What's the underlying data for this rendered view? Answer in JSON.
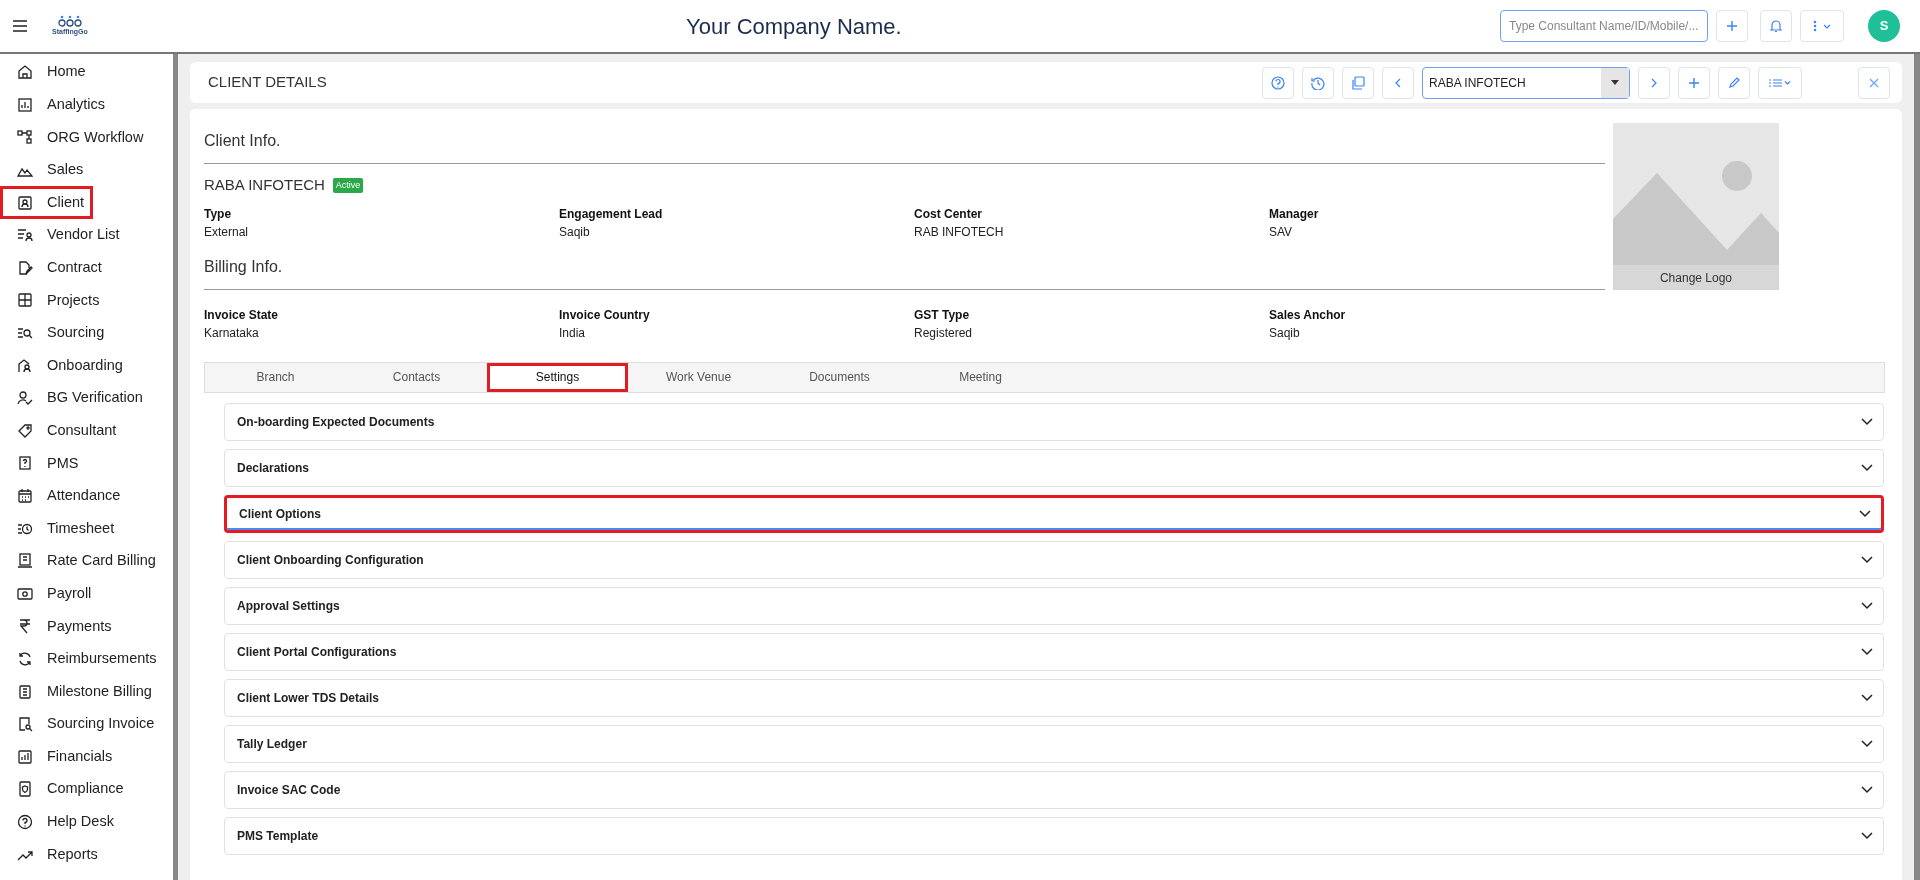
{
  "topbar": {
    "logo_text": "StaffingGo",
    "company": "Your Company Name.",
    "search": {
      "placeholder": "Type Consultant Name/ID/Mobile/..."
    },
    "avatar": "S"
  },
  "sidebar": {
    "items": [
      {
        "label": "Home",
        "highlighted": false
      },
      {
        "label": "Analytics",
        "highlighted": false
      },
      {
        "label": "ORG Workflow",
        "highlighted": false
      },
      {
        "label": "Sales",
        "highlighted": false
      },
      {
        "label": "Client",
        "highlighted": true
      },
      {
        "label": "Vendor List",
        "highlighted": false
      },
      {
        "label": "Contract",
        "highlighted": false
      },
      {
        "label": "Projects",
        "highlighted": false
      },
      {
        "label": "Sourcing",
        "highlighted": false
      },
      {
        "label": "Onboarding",
        "highlighted": false
      },
      {
        "label": "BG Verification",
        "highlighted": false
      },
      {
        "label": "Consultant",
        "highlighted": false
      },
      {
        "label": "PMS",
        "highlighted": false
      },
      {
        "label": "Attendance",
        "highlighted": false
      },
      {
        "label": "Timesheet",
        "highlighted": false
      },
      {
        "label": "Rate Card Billing",
        "highlighted": false
      },
      {
        "label": "Payroll",
        "highlighted": false
      },
      {
        "label": "Payments",
        "highlighted": false
      },
      {
        "label": "Reimbursements",
        "highlighted": false
      },
      {
        "label": "Milestone Billing",
        "highlighted": false
      },
      {
        "label": "Sourcing Invoice",
        "highlighted": false
      },
      {
        "label": "Financials",
        "highlighted": false
      },
      {
        "label": "Compliance",
        "highlighted": false
      },
      {
        "label": "Help Desk",
        "highlighted": false
      },
      {
        "label": "Reports",
        "highlighted": false
      }
    ]
  },
  "header": {
    "title": "CLIENT DETAILS",
    "client_select": "RABA INFOTECH"
  },
  "client_info": {
    "heading": "Client Info.",
    "name": "RABA INFOTECH",
    "status": "Active",
    "fields": [
      {
        "label": "Type",
        "value": "External"
      },
      {
        "label": "Engagement Lead",
        "value": "Saqib"
      },
      {
        "label": "Cost Center",
        "value": "RAB INFOTECH"
      },
      {
        "label": "Manager",
        "value": "SAV"
      }
    ]
  },
  "billing_info": {
    "heading": "Billing Info.",
    "fields": [
      {
        "label": "Invoice State",
        "value": "Karnataka"
      },
      {
        "label": "Invoice Country",
        "value": "India"
      },
      {
        "label": "GST Type",
        "value": "Registered"
      },
      {
        "label": "Sales Anchor",
        "value": "Saqib"
      }
    ]
  },
  "logo": {
    "button": "Change Logo"
  },
  "tabs": [
    {
      "label": "Branch",
      "selected": false,
      "highlighted": false
    },
    {
      "label": "Contacts",
      "selected": false,
      "highlighted": false
    },
    {
      "label": "Settings",
      "selected": true,
      "highlighted": true
    },
    {
      "label": "Work Venue",
      "selected": false,
      "highlighted": false
    },
    {
      "label": "Documents",
      "selected": false,
      "highlighted": false
    },
    {
      "label": "Meeting",
      "selected": false,
      "highlighted": false
    }
  ],
  "accordions": [
    {
      "title": "On-boarding Expected Documents",
      "highlighted": false,
      "focused": false
    },
    {
      "title": "Declarations",
      "highlighted": false,
      "focused": false
    },
    {
      "title": "Client Options",
      "highlighted": true,
      "focused": true
    },
    {
      "title": "Client Onboarding Configuration",
      "highlighted": false,
      "focused": false
    },
    {
      "title": "Approval Settings",
      "highlighted": false,
      "focused": false
    },
    {
      "title": "Client Portal Configurations",
      "highlighted": false,
      "focused": false
    },
    {
      "title": "Client Lower TDS Details",
      "highlighted": false,
      "focused": false
    },
    {
      "title": "Tally Ledger",
      "highlighted": false,
      "focused": false
    },
    {
      "title": "Invoice SAC Code",
      "highlighted": false,
      "focused": false
    },
    {
      "title": "PMS Template",
      "highlighted": false,
      "focused": false
    }
  ]
}
